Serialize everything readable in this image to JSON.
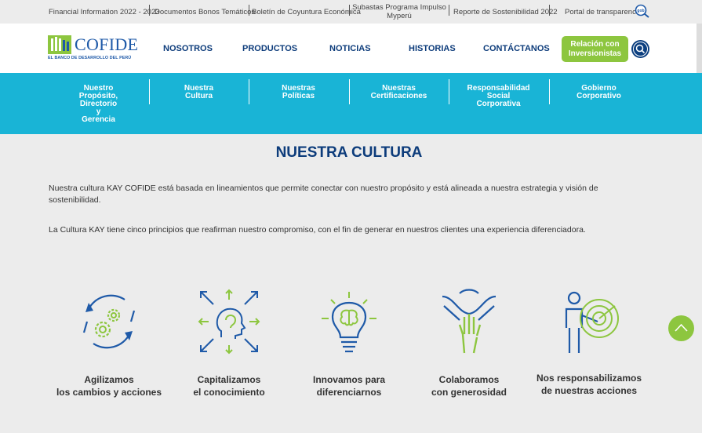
{
  "topbar": {
    "links": [
      "Financial Information 2022 - 2023",
      "Documentos Bonos Temáticos",
      "Boletín de Coyuntura Económica",
      "Subastas Programa Impulso Myperú",
      "Reporte de Sostenibilidad 2022",
      "Portal de transparencia"
    ],
    "gob_icon": "gob-pe-search-icon"
  },
  "header": {
    "logo_text": "COFIDE",
    "logo_sub": "EL BANCO DE DESARROLLO DEL PERÚ",
    "nav": [
      "NOSOTROS",
      "PRODUCTOS",
      "NOTICIAS",
      "HISTORIAS",
      "CONTÁCTANOS"
    ],
    "investors_button": "Relación con Inversionistas",
    "search_icon": "search-icon"
  },
  "subnav": {
    "items": [
      "Nuestro Propósito, Directorio y Gerencia",
      "Nuestra Cultura",
      "Nuestras Políticas",
      "Nuestras Certificaciones",
      "Responsabilidad Social Corporativa",
      "Gobierno Corporativo"
    ]
  },
  "main": {
    "title": "NUESTRA CULTURA",
    "paragraph1": "Nuestra cultura KAY COFIDE  está basada en lineamientos que permite conectar con nuestro propósito y está alineada a nuestra estrategia y visión de sostenibilidad.",
    "paragraph2": "La Cultura KAY tiene cinco principios que reafirman nuestro compromiso, con el fin de generar en nuestros clientes una experiencia diferenciadora.",
    "principles": [
      {
        "line1": "Agilizamos",
        "line2": "los cambios y acciones",
        "icon": "gears-cycle-icon"
      },
      {
        "line1": "Capitalizamos",
        "line2": "el conocimiento",
        "icon": "head-knowledge-icon"
      },
      {
        "line1": "Innovamos para",
        "line2": "diferenciarnos",
        "icon": "lightbulb-brain-icon"
      },
      {
        "line1": "Colaboramos",
        "line2": "con generosidad",
        "icon": "hands-collaboration-icon"
      },
      {
        "line1": "Nos responsabilizamos",
        "line2": "de nuestras acciones",
        "icon": "person-target-icon"
      }
    ]
  },
  "colors": {
    "navy": "#0d3c7b",
    "cyan": "#19b4d6",
    "green": "#8dc63f",
    "background": "#ececec"
  },
  "scroll_top_icon": "chevron-up-icon"
}
